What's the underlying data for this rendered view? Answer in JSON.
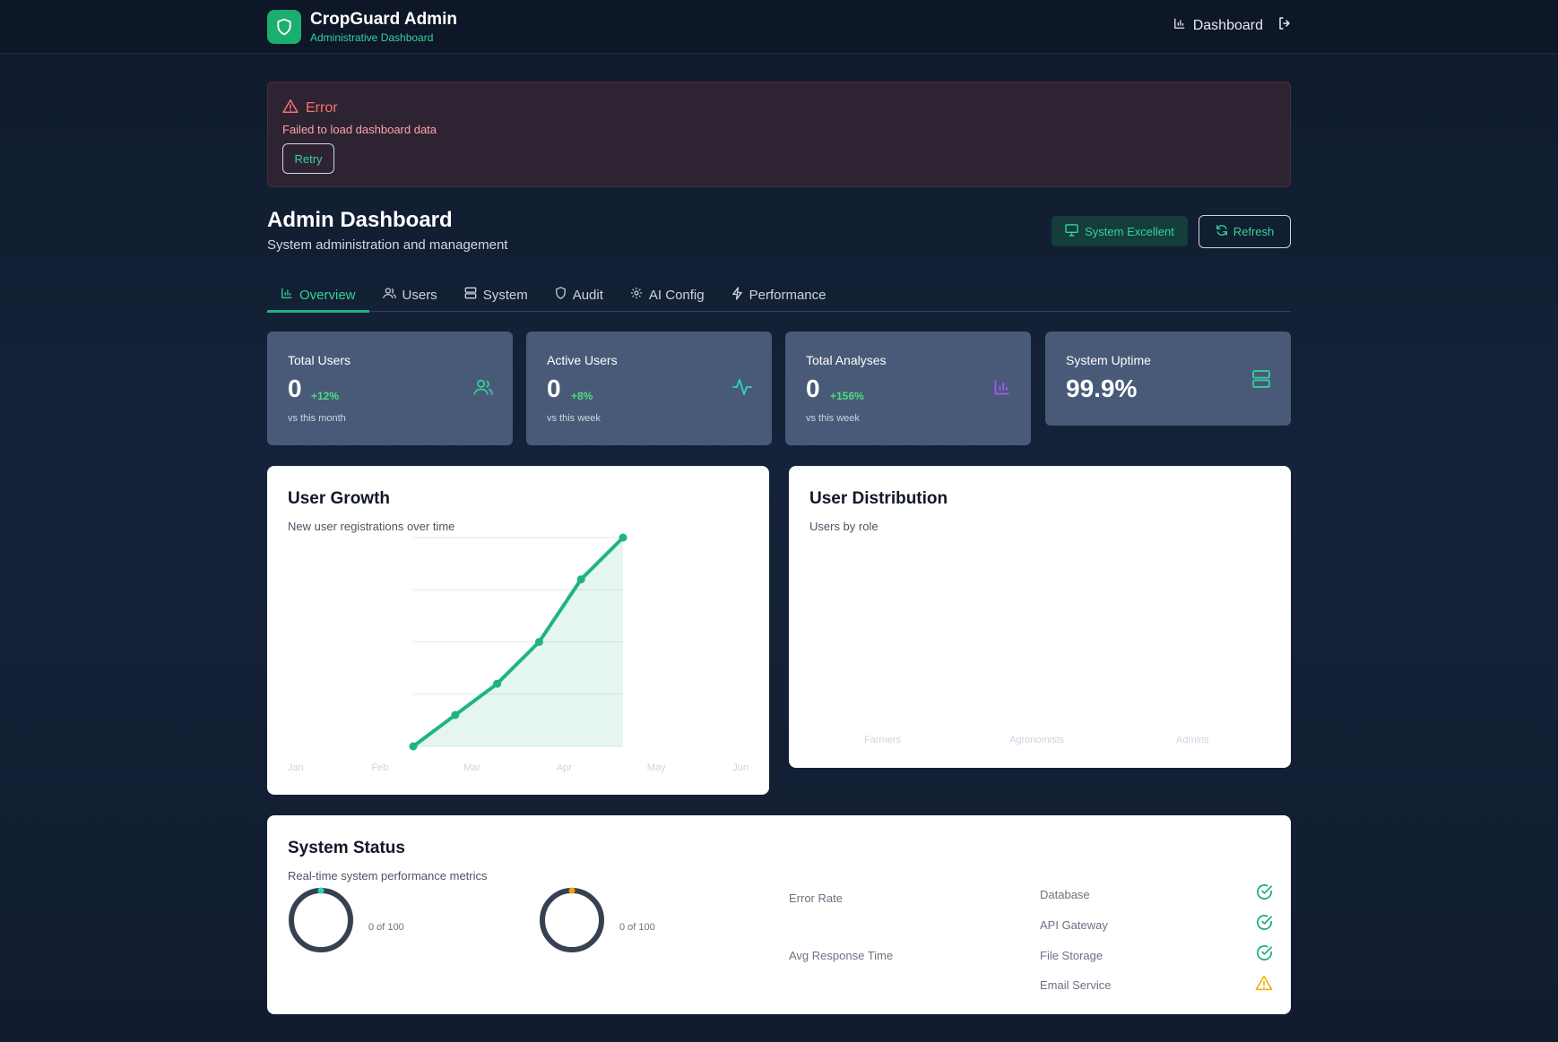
{
  "header": {
    "title": "CropGuard Admin",
    "subtitle": "Administrative Dashboard",
    "nav_dashboard": "Dashboard"
  },
  "error": {
    "title": "Error",
    "message": "Failed to load dashboard data",
    "retry_label": "Retry"
  },
  "page": {
    "title": "Admin Dashboard",
    "subtitle": "System administration and management",
    "status_label": "System Excellent",
    "refresh_label": "Refresh"
  },
  "tabs": [
    {
      "label": "Overview",
      "icon": "bar-chart-icon",
      "active": true
    },
    {
      "label": "Users",
      "icon": "users-icon",
      "active": false
    },
    {
      "label": "System",
      "icon": "server-icon",
      "active": false
    },
    {
      "label": "Audit",
      "icon": "shield-icon",
      "active": false
    },
    {
      "label": "AI Config",
      "icon": "gear-icon",
      "active": false
    },
    {
      "label": "Performance",
      "icon": "lightning-icon",
      "active": false
    }
  ],
  "stats": [
    {
      "label": "Total Users",
      "value": "0",
      "delta": "+12%",
      "note": "vs this month",
      "icon": "users-icon",
      "icon_color": "#34d399"
    },
    {
      "label": "Active Users",
      "value": "0",
      "delta": "+8%",
      "note": "vs this week",
      "icon": "activity-icon",
      "icon_color": "#2dd4bf"
    },
    {
      "label": "Total Analyses",
      "value": "0",
      "delta": "+156%",
      "note": "vs this week",
      "icon": "bar-chart-icon",
      "icon_color": "#a855f7"
    },
    {
      "label": "System Uptime",
      "value": "99.9%",
      "icon": "server-icon",
      "icon_color": "#34d399"
    }
  ],
  "user_growth": {
    "title": "User Growth",
    "subtitle": "New user registrations over time"
  },
  "chart_data": {
    "type": "area",
    "title": "User Growth",
    "x": [
      "Jan",
      "Feb",
      "Mar",
      "Apr",
      "May",
      "Jun"
    ],
    "series": [
      {
        "values": [
          0,
          15,
          30,
          50,
          80,
          100
        ]
      }
    ],
    "ylim": [
      0,
      100
    ],
    "grid": true,
    "color": "#1fb57c"
  },
  "user_distribution": {
    "title": "User Distribution",
    "subtitle": "Users by role",
    "categories": [
      "Farmers",
      "Agronomists",
      "Admins"
    ]
  },
  "system_status": {
    "title": "System Status",
    "subtitle": "Real-time system performance metrics",
    "gauges": [
      {
        "note": "0 of 100",
        "value": 0,
        "indicator_color": "#2dd4bf"
      },
      {
        "note": "0 of 100",
        "value": 0,
        "indicator_color": "#f59e0b"
      }
    ],
    "metrics": [
      "Error Rate",
      "Avg Response Time"
    ],
    "services": [
      {
        "name": "Database",
        "status": "ok",
        "icon": "check-circle-icon"
      },
      {
        "name": "API Gateway",
        "status": "ok",
        "icon": "check-circle-icon"
      },
      {
        "name": "File Storage",
        "status": "ok",
        "icon": "check-circle-icon"
      },
      {
        "name": "Email Service",
        "status": "warning",
        "icon": "warning-icon"
      }
    ]
  }
}
